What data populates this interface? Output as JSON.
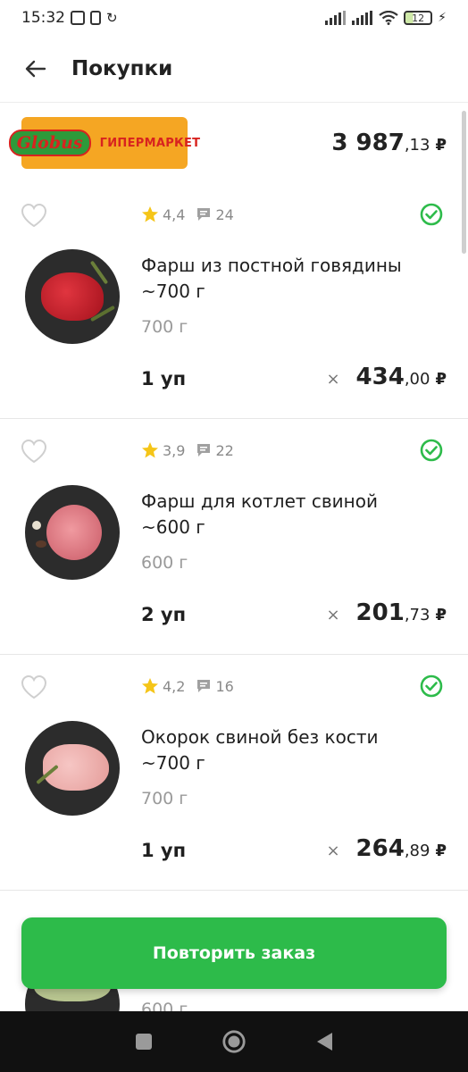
{
  "status_bar": {
    "time": "15:32",
    "battery": "12"
  },
  "header": {
    "title": "Покупки"
  },
  "store": {
    "logo_brand": "Globus",
    "logo_type": "ГИПЕРМАРКЕТ",
    "total_int": "3 987",
    "total_dec": ",13",
    "currency": "₽"
  },
  "items": [
    {
      "rating": "4,4",
      "reviews": "24",
      "name": "Фарш из постной говядины ~700 г",
      "weight": "700 г",
      "qty": "1 уп",
      "price_int": "434",
      "price_dec": ",00",
      "currency": "₽",
      "times": "×"
    },
    {
      "rating": "3,9",
      "reviews": "22",
      "name": "Фарш для котлет свиной ~600 г",
      "weight": "600 г",
      "qty": "2 уп",
      "price_int": "201",
      "price_dec": ",73",
      "currency": "₽",
      "times": "×"
    },
    {
      "rating": "4,2",
      "reviews": "16",
      "name": "Окорок свиной без кости ~700 г",
      "weight": "700 г",
      "qty": "1 уп",
      "price_int": "264",
      "price_dec": ",89",
      "currency": "₽",
      "times": "×"
    }
  ],
  "partial_item": {
    "weight": "600 г"
  },
  "repeat_button": {
    "label": "Повторить заказ"
  },
  "colors": {
    "accent": "#2dbb4a",
    "star": "#f5c518",
    "logo_bg": "#f5a623"
  },
  "icons": [
    "back-arrow-icon",
    "heart-icon",
    "star-icon",
    "comment-icon",
    "check-circle-icon",
    "nav-recents-icon",
    "nav-home-icon",
    "nav-back-icon"
  ]
}
